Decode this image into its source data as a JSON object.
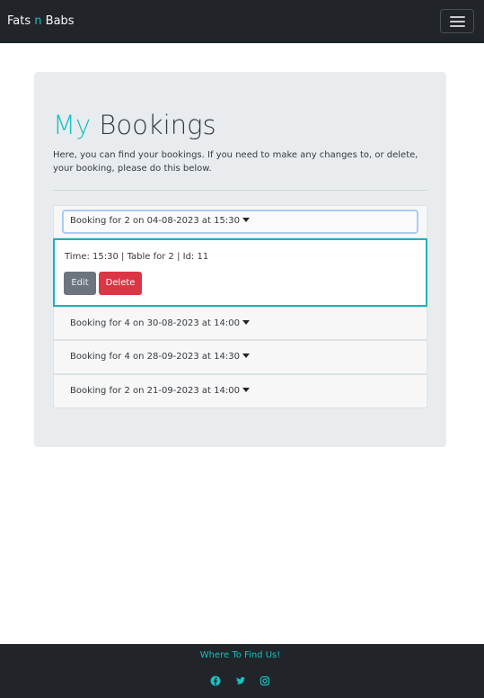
{
  "navbar": {
    "brand_part1": "Fats ",
    "brand_accent": "n",
    "brand_part2": " Babs",
    "menu_icon": "hamburger-menu-icon"
  },
  "main": {
    "title_accent": "My",
    "title_rest": " Bookings",
    "lead": "Here, you can find your bookings. If you need to make any changes to, or delete, your booking, please do this below."
  },
  "bookings": [
    {
      "header": "Booking for 2 on 04-08-2023 at 15:30",
      "expanded": true,
      "details": "Time: 15:30 | Table for 2 | Id: 11",
      "edit_label": "Edit",
      "delete_label": "Delete"
    },
    {
      "header": "Booking for 4 on 30-08-2023 at 14:00",
      "expanded": false
    },
    {
      "header": "Booking for 4 on 28-09-2023 at 14:30",
      "expanded": false
    },
    {
      "header": "Booking for 2 on 21-09-2023 at 14:00",
      "expanded": false
    }
  ],
  "footer": {
    "heading": "Where To Find Us!",
    "social_icons": [
      "facebook-icon",
      "twitter-icon",
      "instagram-icon"
    ]
  },
  "colors": {
    "accent": "#17c1c1",
    "dark": "#212529",
    "danger": "#dc3545",
    "secondary": "#6c757d",
    "jumbotron": "#e9ecef"
  }
}
